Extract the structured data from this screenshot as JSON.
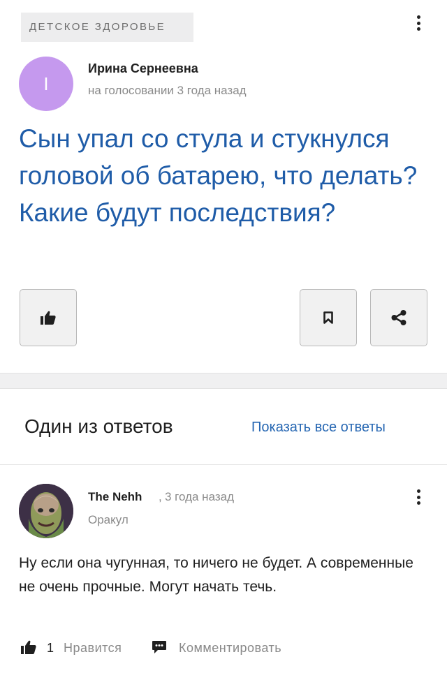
{
  "question": {
    "category": "ДЕТСКОЕ ЗДОРОВЬЕ",
    "author_initial": "I",
    "author_name": "Ирина Сернеевна",
    "meta": "на голосовании 3 года назад",
    "title": "Сын упал со стула и стукнулся головой об батарею, что делать? Какие будут последствия?",
    "avatar_color": "#c599ee",
    "title_color": "#1f5ca8",
    "icons": {
      "like": "thumbs-up-icon",
      "bookmark": "bookmark-icon",
      "share": "share-icon",
      "menu": "more-vertical-icon"
    }
  },
  "answers": {
    "heading": "Один из ответов",
    "show_all": "Показать все ответы",
    "link_color": "#2566b2"
  },
  "answer": {
    "author_name": "The Nehh",
    "separator": ",",
    "time": "3 года назад",
    "rank": "Оракул",
    "text": "Ну если она чугунная, то ничего не будет. А современные не очень прочные. Могут начать течь.",
    "likes_count": "1",
    "like_label": "Нравится",
    "comment_label": "Комментировать"
  }
}
